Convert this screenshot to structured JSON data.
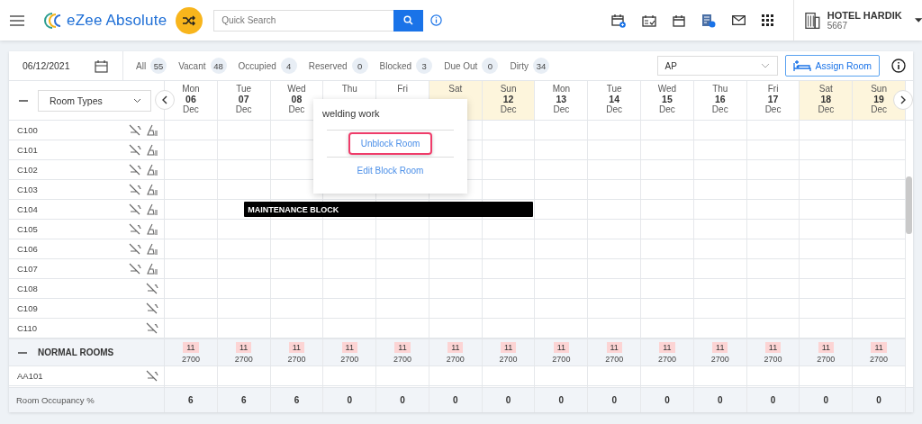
{
  "app": {
    "logo_text": "eZee Absolute",
    "search": {
      "placeholder": "Quick Search"
    },
    "hotel": {
      "name": "HOTEL HARDIK",
      "code": "5667"
    }
  },
  "toolbar": {
    "date": "06/12/2021",
    "counters": [
      {
        "label": "All",
        "count": "55"
      },
      {
        "label": "Vacant",
        "count": "48"
      },
      {
        "label": "Occupied",
        "count": "4"
      },
      {
        "label": "Reserved",
        "count": "0"
      },
      {
        "label": "Blocked",
        "count": "3"
      },
      {
        "label": "Due Out",
        "count": "0"
      },
      {
        "label": "Dirty",
        "count": "34"
      }
    ],
    "rate_plan": "AP",
    "assign_button": "Assign Room"
  },
  "room_type_select": "Room Types",
  "days": [
    {
      "day": "Mon",
      "date": "06",
      "month": "Dec",
      "weekend": false
    },
    {
      "day": "Tue",
      "date": "07",
      "month": "Dec",
      "weekend": false
    },
    {
      "day": "Wed",
      "date": "08",
      "month": "Dec",
      "weekend": false
    },
    {
      "day": "Thu",
      "weekend": false
    },
    {
      "day": "Fri",
      "weekend": false
    },
    {
      "day": "Sat",
      "weekend": true
    },
    {
      "day": "Sun",
      "date": "12",
      "month": "Dec",
      "weekend": true
    },
    {
      "day": "Mon",
      "date": "13",
      "month": "Dec",
      "weekend": false
    },
    {
      "day": "Tue",
      "date": "14",
      "month": "Dec",
      "weekend": false
    },
    {
      "day": "Wed",
      "date": "15",
      "month": "Dec",
      "weekend": false
    },
    {
      "day": "Thu",
      "date": "16",
      "month": "Dec",
      "weekend": false
    },
    {
      "day": "Fri",
      "date": "17",
      "month": "Dec",
      "weekend": false
    },
    {
      "day": "Sat",
      "date": "18",
      "month": "Dec",
      "weekend": true
    },
    {
      "day": "Sun",
      "date": "19",
      "month": "Dec",
      "weekend": true
    }
  ],
  "rooms": [
    {
      "name": "C100",
      "dirty": true
    },
    {
      "name": "C101",
      "dirty": true
    },
    {
      "name": "C102",
      "dirty": true
    },
    {
      "name": "C103",
      "dirty": true
    },
    {
      "name": "C104",
      "dirty": true,
      "block": {
        "label": "MAINTENANCE BLOCK"
      }
    },
    {
      "name": "C105",
      "dirty": true
    },
    {
      "name": "C106",
      "dirty": true
    },
    {
      "name": "C107",
      "dirty": true
    },
    {
      "name": "C108",
      "dirty": false
    },
    {
      "name": "C109",
      "dirty": false
    },
    {
      "name": "C110",
      "dirty": false
    }
  ],
  "group": {
    "name": "NORMAL ROOMS",
    "availability": [
      {
        "count": "11",
        "rate": "2700"
      },
      {
        "count": "11",
        "rate": "2700"
      },
      {
        "count": "11",
        "rate": "2700"
      },
      {
        "count": "11",
        "rate": "2700"
      },
      {
        "count": "11",
        "rate": "2700"
      },
      {
        "count": "11",
        "rate": "2700"
      },
      {
        "count": "11",
        "rate": "2700"
      },
      {
        "count": "11",
        "rate": "2700"
      },
      {
        "count": "11",
        "rate": "2700"
      },
      {
        "count": "11",
        "rate": "2700"
      },
      {
        "count": "11",
        "rate": "2700"
      },
      {
        "count": "11",
        "rate": "2700"
      },
      {
        "count": "11",
        "rate": "2700"
      },
      {
        "count": "11",
        "rate": "2700"
      }
    ],
    "rooms": [
      {
        "name": "AA101",
        "dirty": false
      }
    ]
  },
  "occupancy": {
    "label": "Room Occupancy %",
    "values": [
      "6",
      "6",
      "6",
      "0",
      "0",
      "0",
      "0",
      "0",
      "0",
      "0",
      "0",
      "0",
      "0",
      "0"
    ]
  },
  "popover": {
    "title": "welding work",
    "actions": [
      {
        "label": "Unblock Room",
        "selected": true
      },
      {
        "label": "Edit Block Room",
        "selected": false
      }
    ]
  }
}
